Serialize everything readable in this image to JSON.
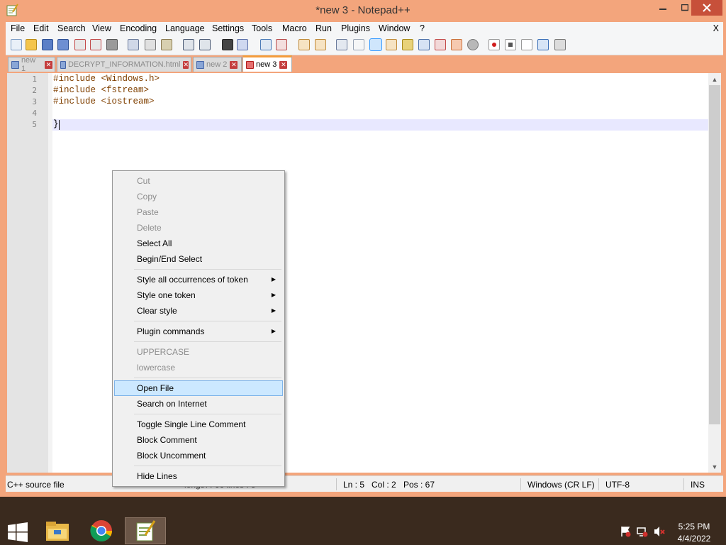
{
  "window": {
    "title": "*new 3 - Notepad++",
    "close_glyph": "X"
  },
  "menu": [
    "File",
    "Edit",
    "Search",
    "View",
    "Encoding",
    "Language",
    "Settings",
    "Tools",
    "Macro",
    "Run",
    "Plugins",
    "Window",
    "?"
  ],
  "tabs": [
    {
      "label": "new 1"
    },
    {
      "label": "DECRYPT_INFORMATION.html"
    },
    {
      "label": "new 2"
    },
    {
      "label": "new 3"
    }
  ],
  "editor": {
    "line_numbers": [
      "1",
      "2",
      "3",
      "4",
      "5"
    ],
    "lines": [
      "#include <Windows.h>",
      "#include <fstream>",
      "#include <iostream>",
      "",
      "}"
    ]
  },
  "status": {
    "file_type": "C++ source file",
    "ln": "Ln : 5",
    "col": "Col : 2",
    "pos": "Pos : 67",
    "eol": "Windows (CR LF)",
    "encoding": "UTF-8",
    "mode": "INS",
    "partial": "length : 66    lines : 5"
  },
  "context_menu": {
    "cut": "Cut",
    "copy": "Copy",
    "paste": "Paste",
    "delete": "Delete",
    "select_all": "Select All",
    "begin_end_select": "Begin/End Select",
    "style_all": "Style all occurrences of token",
    "style_one": "Style one token",
    "clear_style": "Clear style",
    "plugin_commands": "Plugin commands",
    "uppercase": "UPPERCASE",
    "lowercase": "lowercase",
    "open_file": "Open File",
    "search_internet": "Search on Internet",
    "toggle_comment": "Toggle Single Line Comment",
    "block_comment": "Block Comment",
    "block_uncomment": "Block Uncomment",
    "hide_lines": "Hide Lines",
    "submenu_glyph": "▶"
  },
  "taskbar": {
    "time": "5:25 PM",
    "date": "4/4/2022"
  },
  "icons": [
    "notepadpp-icon",
    "windows-start-icon",
    "file-explorer-icon",
    "chrome-icon",
    "flag-icon",
    "network-icon",
    "volume-muted-icon"
  ]
}
